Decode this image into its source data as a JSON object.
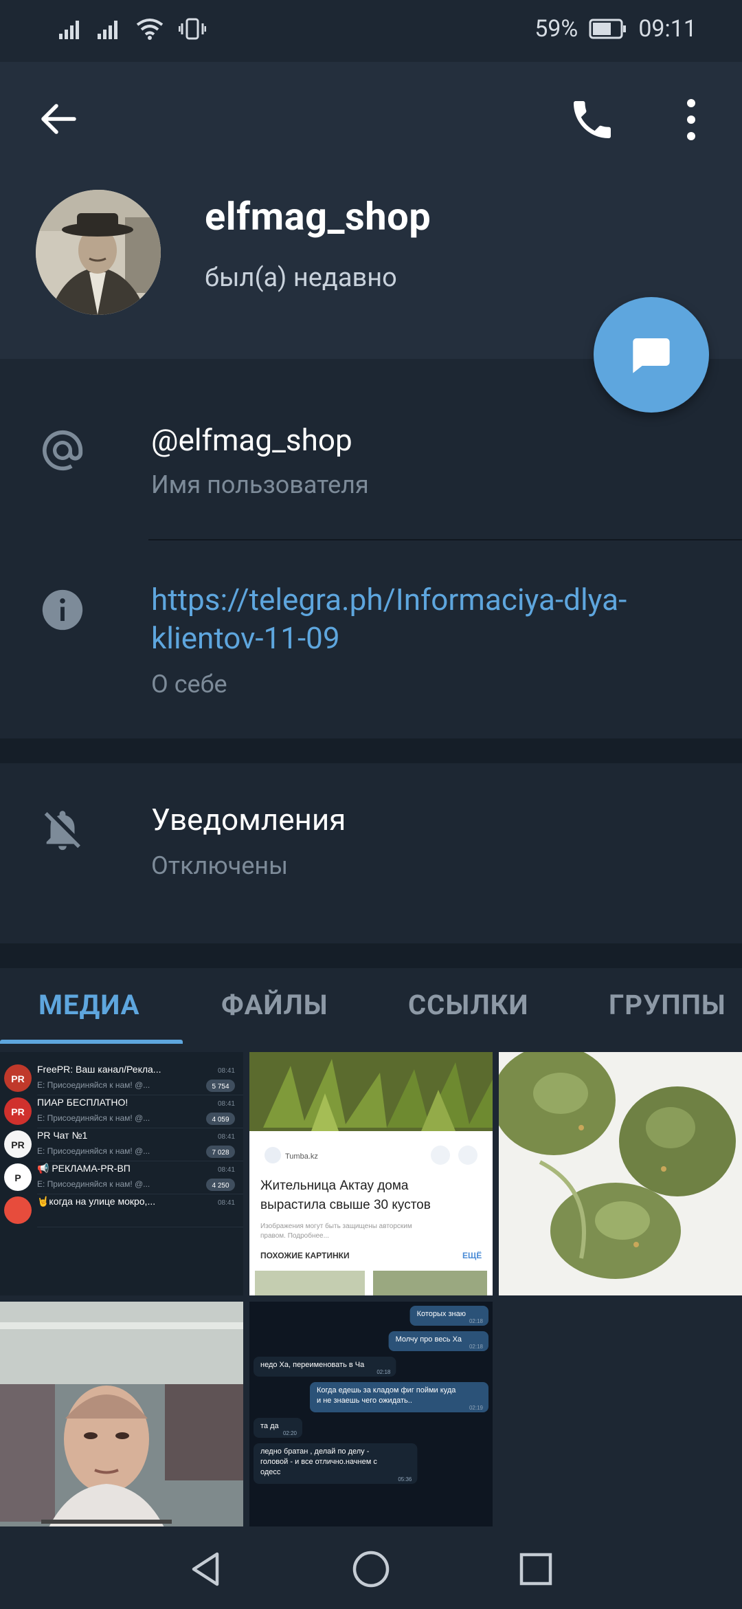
{
  "status_bar": {
    "battery": "59%",
    "time": "09:11"
  },
  "header": {
    "name": "elfmag_shop",
    "status": "был(а) недавно"
  },
  "info": {
    "username": "@elfmag_shop",
    "username_label": "Имя пользователя",
    "bio_link": "https://telegra.ph/Informaciya-dlya-klientov-11-09",
    "bio_label": "О себе"
  },
  "notifications": {
    "title": "Уведомления",
    "value": "Отключены"
  },
  "tabs": [
    {
      "label": "МЕДИА"
    },
    {
      "label": "ФАЙЛЫ"
    },
    {
      "label": "ССЫЛКИ"
    },
    {
      "label": "ГРУППЫ"
    }
  ],
  "media": {
    "chatlist": [
      {
        "title": "FreePR: Ваш канал/Рекла...",
        "preview": "Е: Присоединяйся к нам! @...",
        "time": "08:41",
        "count": "5 754",
        "avatar": "PR"
      },
      {
        "title": "ПИАР БЕСПЛАТНО!",
        "preview": "Е: Присоединяйся к нам! @...",
        "time": "08:41",
        "count": "4 059",
        "avatar": "PR"
      },
      {
        "title": "PR Чат №1",
        "preview": "Е: Присоединяйся к нам! @...",
        "time": "08:41",
        "count": "7 028",
        "avatar": "PR"
      },
      {
        "title": "📢 РЕКЛАМА-PR-ВП",
        "preview": "Е: Присоединяйся к нам! @...",
        "time": "08:41",
        "count": "4 250",
        "avatar": "P"
      },
      {
        "title": "🤘когда на улице мокро,...",
        "preview": "",
        "time": "08:41",
        "count": "",
        "avatar": ""
      }
    ],
    "news_card": {
      "source": "Tumba.kz",
      "headline": "Жительница Актау дома вырастила свыше 30 кустов",
      "note": "Изображения могут быть защищены авторским правом. Подробнее...",
      "similar": "ПОХОЖИЕ КАРТИНКИ",
      "more": "ЕЩЁ"
    },
    "chat_messages": [
      {
        "text": "Которых знаю",
        "time": "02:18",
        "out": true
      },
      {
        "text": "Молчу про весь Ха",
        "time": "02:18",
        "out": true
      },
      {
        "text": "недо Ха, переименовать в Ча",
        "time": "02:18",
        "out": false
      },
      {
        "text": "Когда едешь за кладом фиг пойми куда и не знаешь чего ожидать..",
        "time": "02:19",
        "out": true
      },
      {
        "text": "та да",
        "time": "02:20",
        "out": false
      },
      {
        "text": "ледно братан , делай по делу - головой - и все отлично.начнем с одесс",
        "time": "05:36",
        "out": false
      }
    ]
  },
  "colors": {
    "accent": "#5ea6de",
    "header_bg": "#242f3d",
    "body_bg": "#1d2733",
    "muted": "#7d8b99"
  }
}
